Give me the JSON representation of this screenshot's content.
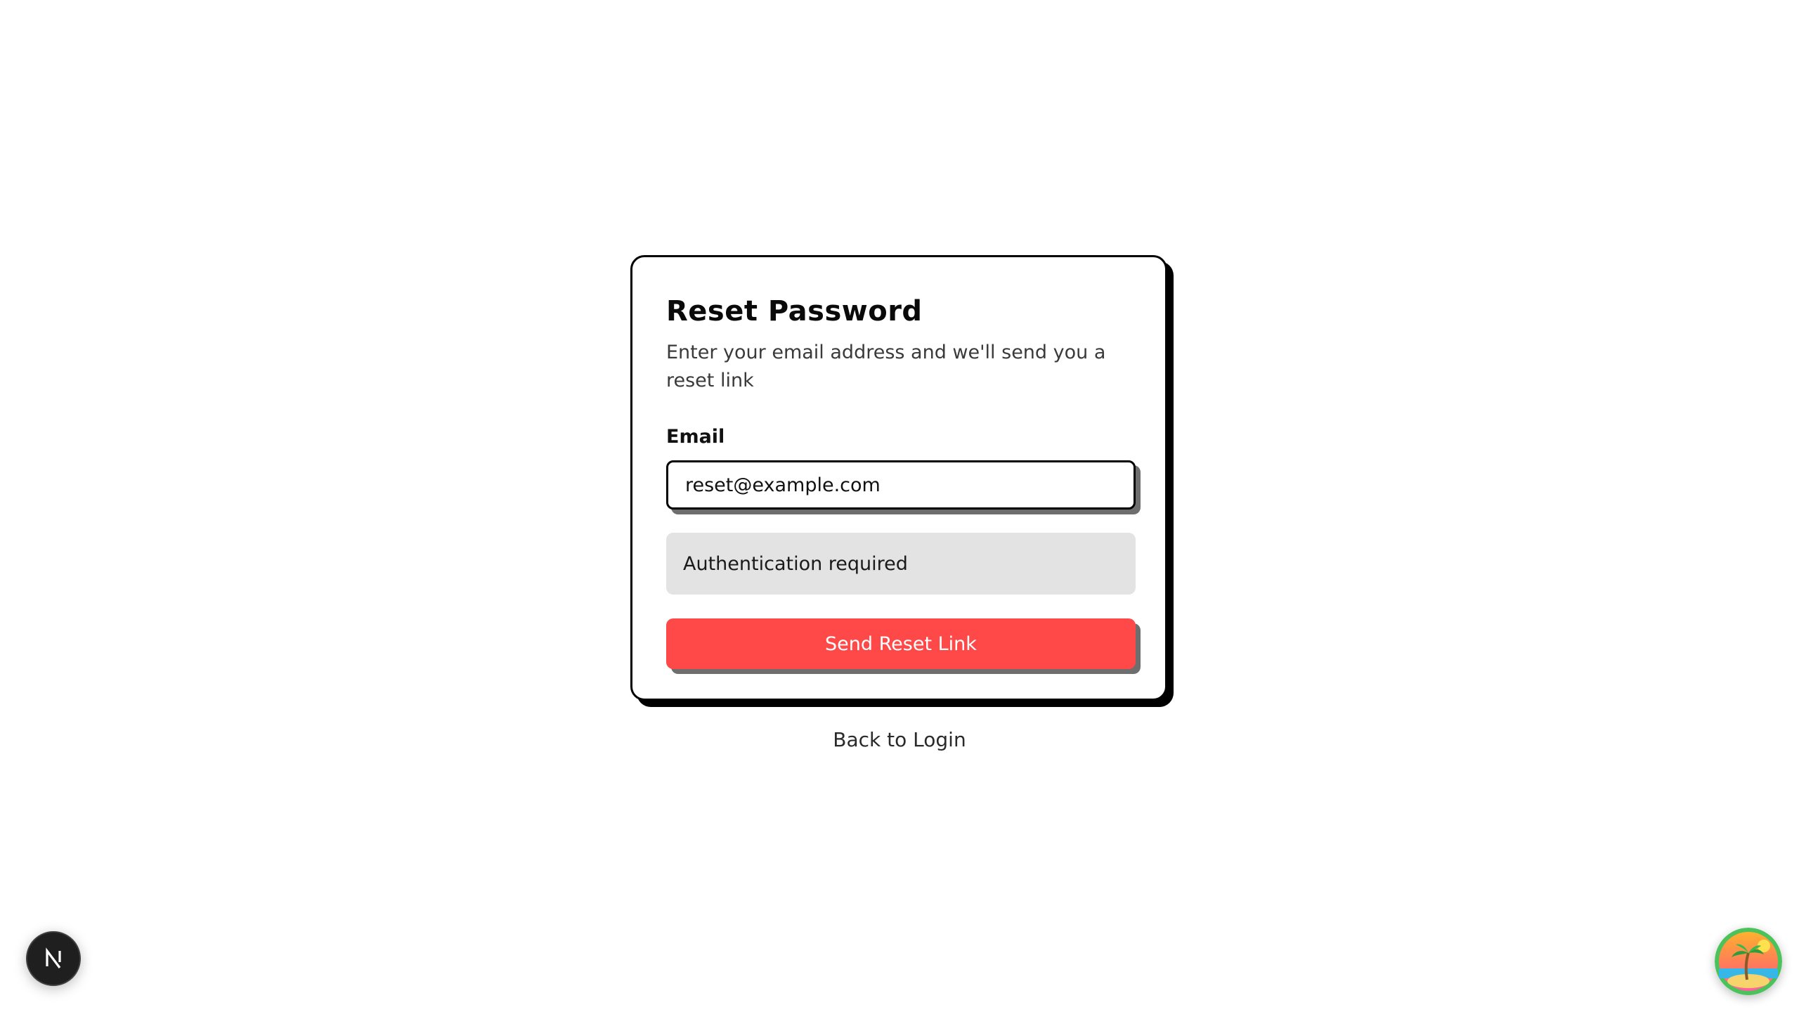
{
  "reset_card": {
    "title": "Reset Password",
    "subtitle": "Enter your email address and we'll send you a reset link",
    "email_label": "Email",
    "email_value": "reset@example.com",
    "alert_message": "Authentication required",
    "submit_label": "Send Reset Link"
  },
  "back_link_label": "Back to Login",
  "colors": {
    "primary_button": "#ff4949",
    "alert_background": "#e3e3e3",
    "card_border": "#000000"
  },
  "icons": {
    "dev_badge": "nextjs-logo-icon",
    "app_avatar": "tropical-island-icon"
  }
}
